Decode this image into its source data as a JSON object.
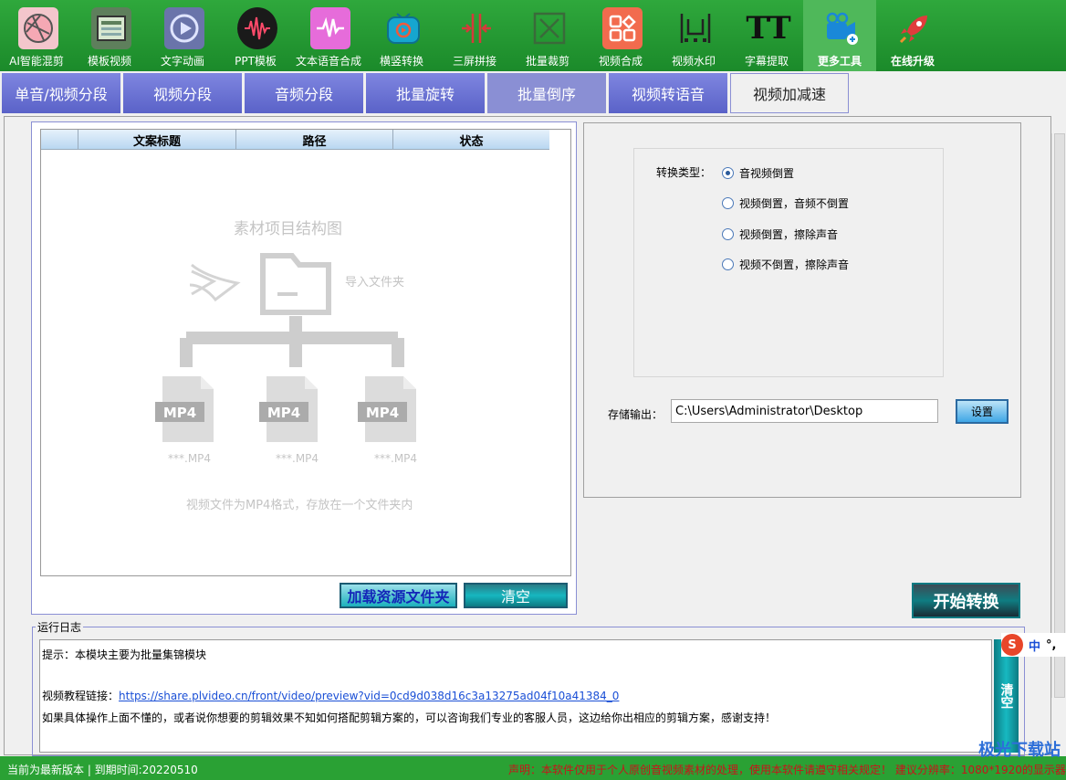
{
  "toolbar": {
    "items": [
      {
        "label": "AI智能混剪",
        "icon": "ball-icon",
        "color": "#e8a0a8"
      },
      {
        "label": "模板视频",
        "icon": "template-icon",
        "color": "#6c8f68"
      },
      {
        "label": "文字动画",
        "icon": "film-icon",
        "color": "#6a7ab0"
      },
      {
        "label": "PPT模板",
        "icon": "wave-icon",
        "color": "#222222"
      },
      {
        "label": "文本语音合成",
        "icon": "voice-icon",
        "color": "#e46cd8"
      },
      {
        "label": "横竖转换",
        "icon": "tv-icon",
        "color": "#1aa0c8"
      },
      {
        "label": "三屏拼接",
        "icon": "split-icon",
        "color": "#d03a3a"
      },
      {
        "label": "批量裁剪",
        "icon": "crop-icon",
        "color": "#4a8a4a"
      },
      {
        "label": "视频合成",
        "icon": "merge-icon",
        "color": "#f07050"
      },
      {
        "label": "视频水印",
        "icon": "watermark-icon",
        "color": "#2a3a2a"
      },
      {
        "label": "字幕提取",
        "icon": "text-icon",
        "color": "#111111"
      },
      {
        "label": "更多工具",
        "icon": "camera-icon",
        "color": "#1a88d8"
      },
      {
        "label": "在线升级",
        "icon": "rocket-icon",
        "color": "#e04040"
      }
    ]
  },
  "tabs": [
    "单音/视频分段",
    "视频分段",
    "音频分段",
    "批量旋转",
    "批量倒序",
    "视频转语音",
    "视频加减速"
  ],
  "file_list": {
    "columns": [
      "文案标题",
      "路径",
      "状态"
    ]
  },
  "placeholder": {
    "title": "素材项目结构图",
    "import": "导入文件夹",
    "file_icon_text": "MP4",
    "file_label": "***.MP4",
    "hint": "视频文件为MP4格式，存放在一个文件夹内"
  },
  "buttons": {
    "load": "加载资源文件夹",
    "clear": "清空",
    "set": "设置",
    "start": "开始转换",
    "log_clear": "清空"
  },
  "conversion": {
    "label": "转换类型：",
    "options": [
      "音视频倒置",
      "视频倒置，音频不倒置",
      "视频倒置，擦除声音",
      "视频不倒置，擦除声音"
    ],
    "selected_index": 0
  },
  "output": {
    "label": "存储输出：",
    "path": "C:\\Users\\Administrator\\Desktop"
  },
  "log": {
    "title": "运行日志",
    "line1": "提示：本模块主要为批量集锦模块",
    "line2_prefix": "视频教程链接：",
    "line2_link": "https://share.plvideo.cn/front/video/preview?vid=0cd9d038d16c3a13275ad04f10a41384_0",
    "line3": "如果具体操作上面不懂的，或者说你想要的剪辑效果不知如何搭配剪辑方案的，可以咨询我们专业的客服人员，这边给你出相应的剪辑方案，感谢支持！"
  },
  "ime": {
    "logo": "S",
    "lang": "中",
    "punct": "°,"
  },
  "status": {
    "left": "当前为最新版本 | 到期时间:20220510",
    "right": "声明：本软件仅用于个人原创音视频素材的处理，使用本软件请遵守相关规定！ 建议分辨率：1080*1920的显示器"
  },
  "watermark": "极光下载站"
}
